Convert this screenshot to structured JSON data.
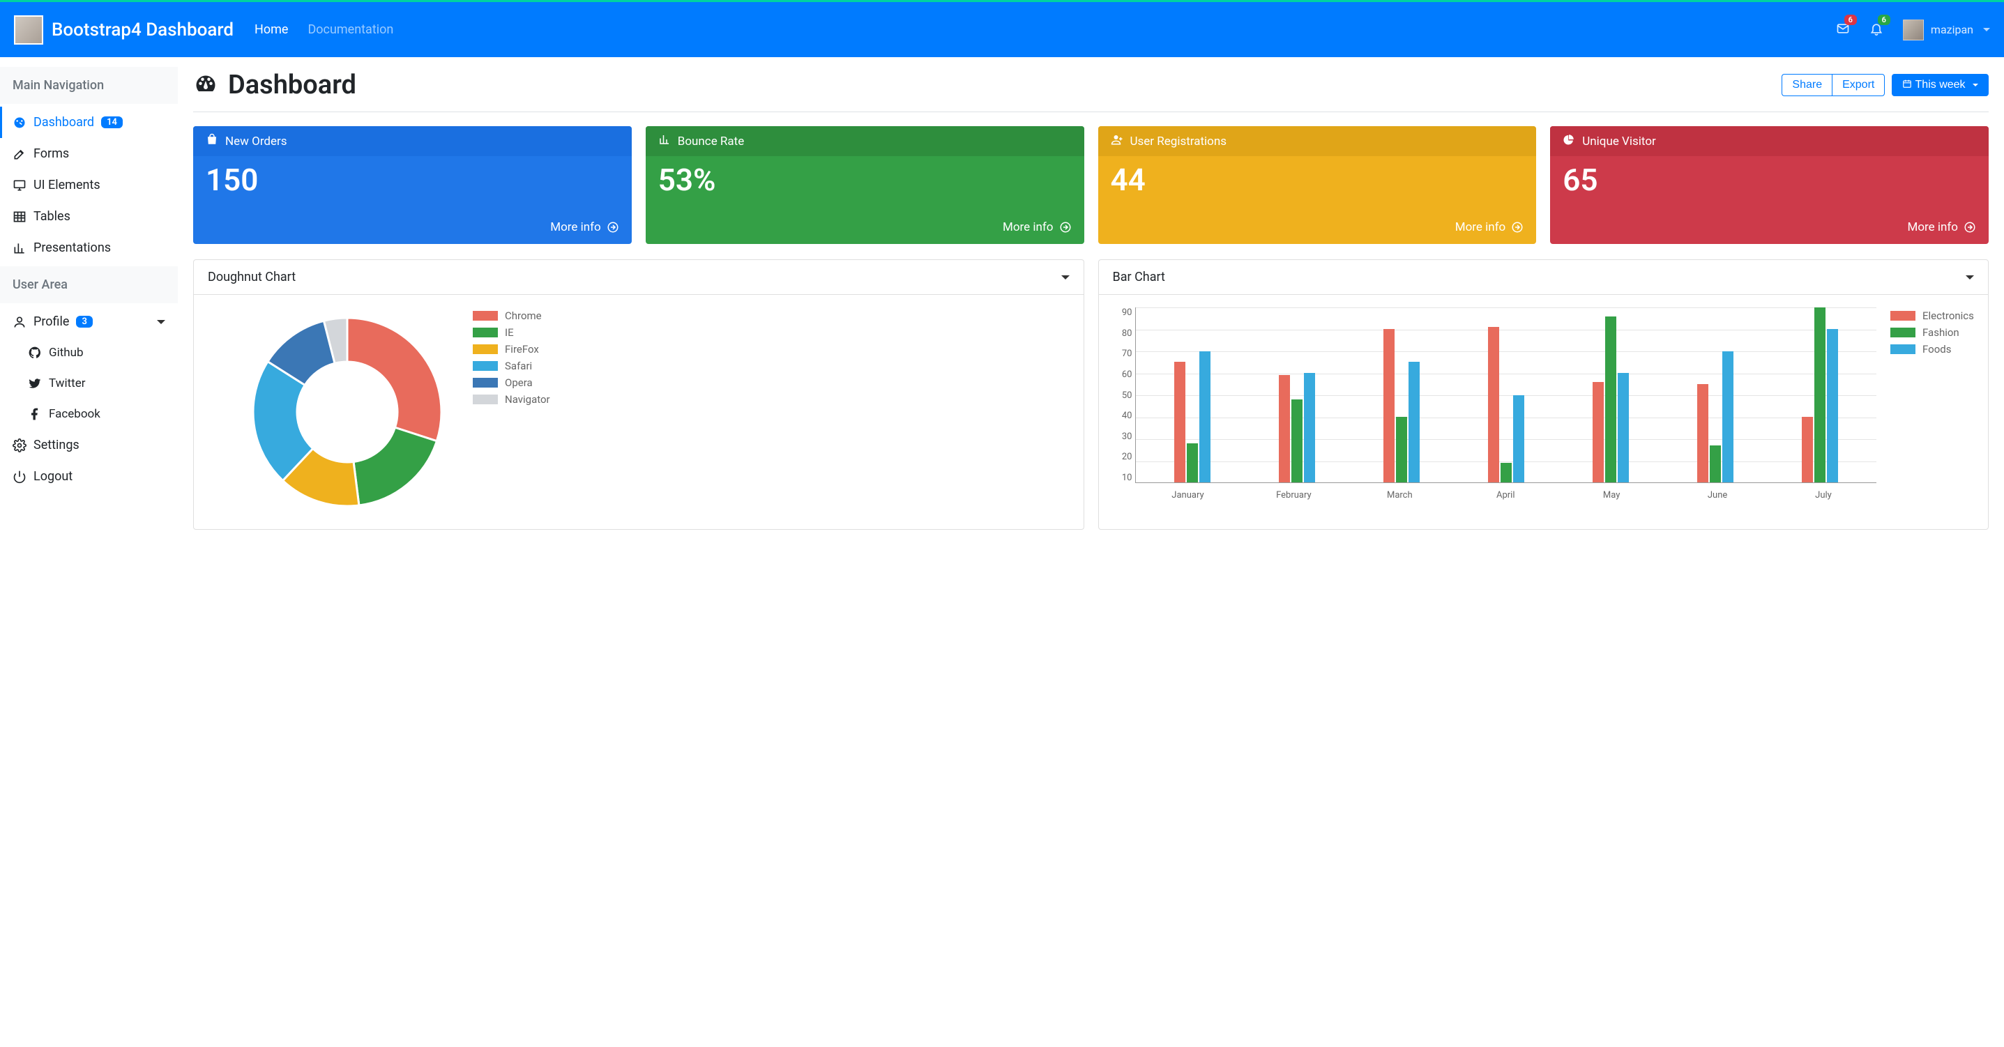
{
  "brand": {
    "title": "Bootstrap4 Dashboard"
  },
  "topnav": {
    "home": "Home",
    "documentation": "Documentation"
  },
  "notifications": {
    "mail_count": "6",
    "bell_count": "6"
  },
  "user": {
    "name": "mazipan"
  },
  "sidebar": {
    "main_header": "Main Navigation",
    "user_header": "User Area",
    "items": {
      "dashboard": {
        "label": "Dashboard",
        "badge": "14"
      },
      "forms": "Forms",
      "ui_elements": "UI Elements",
      "tables": "Tables",
      "presentations": "Presentations",
      "profile": {
        "label": "Profile",
        "badge": "3"
      },
      "github": "Github",
      "twitter": "Twitter",
      "facebook": "Facebook",
      "settings": "Settings",
      "logout": "Logout"
    }
  },
  "page": {
    "title": "Dashboard",
    "actions": {
      "share": "Share",
      "export": "Export",
      "period": "This week"
    }
  },
  "stats": {
    "more_info": "More info",
    "cards": [
      {
        "title": "New Orders",
        "value": "150",
        "color": "blue",
        "icon": "bag"
      },
      {
        "title": "Bounce Rate",
        "value": "53%",
        "color": "green",
        "icon": "bars"
      },
      {
        "title": "User Registrations",
        "value": "44",
        "color": "yellow",
        "icon": "user-plus"
      },
      {
        "title": "Unique Visitor",
        "value": "65",
        "color": "red",
        "icon": "pie"
      }
    ]
  },
  "charts": {
    "doughnut": {
      "title": "Doughnut Chart"
    },
    "bar": {
      "title": "Bar Chart"
    }
  },
  "chart_data": [
    {
      "type": "doughnut",
      "title": "Doughnut Chart",
      "series": [
        {
          "name": "Chrome",
          "value": 30,
          "color": "#e86b5c"
        },
        {
          "name": "IE",
          "value": 18,
          "color": "#34a046"
        },
        {
          "name": "FireFox",
          "value": 14,
          "color": "#efb11e"
        },
        {
          "name": "Safari",
          "value": 22,
          "color": "#37aade"
        },
        {
          "name": "Opera",
          "value": 12,
          "color": "#3b77b5"
        },
        {
          "name": "Navigator",
          "value": 4,
          "color": "#d3d6da"
        }
      ]
    },
    {
      "type": "bar",
      "title": "Bar Chart",
      "categories": [
        "January",
        "February",
        "March",
        "April",
        "May",
        "June",
        "July"
      ],
      "ylim": [
        10,
        90
      ],
      "yticks": [
        10,
        20,
        30,
        40,
        50,
        60,
        70,
        80,
        90
      ],
      "series": [
        {
          "name": "Electronics",
          "color": "#e86b5c",
          "values": [
            65,
            59,
            80,
            81,
            56,
            55,
            40
          ]
        },
        {
          "name": "Fashion",
          "color": "#34a046",
          "values": [
            28,
            48,
            40,
            19,
            86,
            27,
            90
          ]
        },
        {
          "name": "Foods",
          "color": "#37aade",
          "values": [
            70,
            60,
            65,
            50,
            60,
            70,
            80
          ]
        }
      ]
    }
  ]
}
